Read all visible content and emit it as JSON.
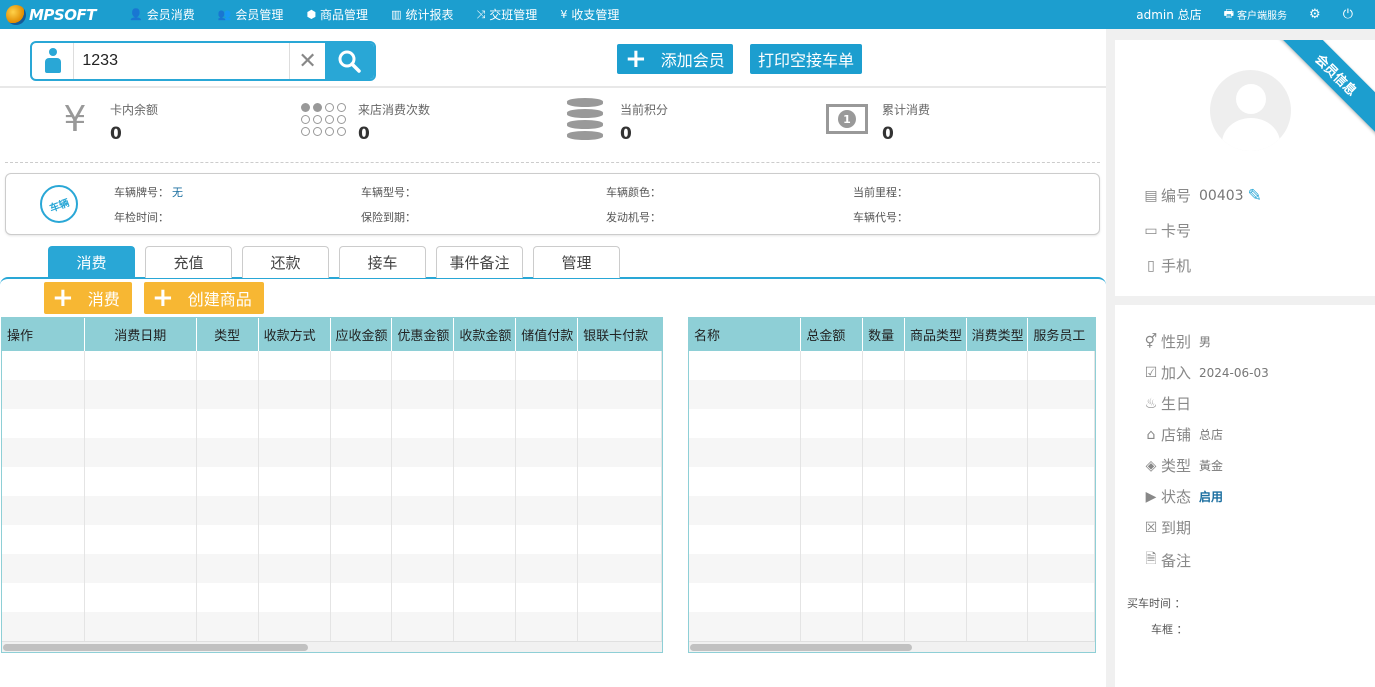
{
  "nav": {
    "logo": "MPSOFT",
    "items": [
      {
        "label": "会员消费",
        "icon": "user-circle-icon",
        "glyph": "👤"
      },
      {
        "label": "会员管理",
        "icon": "users-icon",
        "glyph": "👥"
      },
      {
        "label": "商品管理",
        "icon": "cubes-icon",
        "glyph": "⬢"
      },
      {
        "label": "统计报表",
        "icon": "bar-chart-icon",
        "glyph": "▥"
      },
      {
        "label": "交班管理",
        "icon": "shuffle-icon",
        "glyph": "⤨"
      },
      {
        "label": "收支管理",
        "icon": "yen-icon",
        "glyph": "¥"
      }
    ],
    "user": "admin 总店",
    "client_service": "客户端服务"
  },
  "search": {
    "value": "1233",
    "placeholder": ""
  },
  "buttons": {
    "add_member": "添加会员",
    "print_pickup": "打印空接车单",
    "consume": "消费",
    "create_product": "创建商品"
  },
  "stats": [
    {
      "label": "卡内余额",
      "value": "0",
      "icon": "yen-icon"
    },
    {
      "label": "来店消费次数",
      "value": "0",
      "icon": "dots-icon"
    },
    {
      "label": "当前积分",
      "value": "0",
      "icon": "coins-icon"
    },
    {
      "label": "累计消费",
      "value": "0",
      "icon": "money-icon"
    }
  ],
  "vehicle": {
    "badge": "车辆",
    "plate_label": "车辆牌号：",
    "plate_value": "无",
    "model_label": "车辆型号：",
    "color_label": "车辆颜色：",
    "mileage_label": "当前里程：",
    "inspection_label": "年检时间：",
    "insurance_label": "保险到期：",
    "engine_label": "发动机号：",
    "code_label": "车辆代号："
  },
  "tabs": [
    "消费",
    "充值",
    "还款",
    "接车",
    "事件备注",
    "管理"
  ],
  "left_table": {
    "columns": [
      "操作",
      "消费日期",
      "类型",
      "收款方式",
      "应收金额",
      "优惠金额",
      "收款金额",
      "储值付款",
      "银联卡付款"
    ]
  },
  "right_table": {
    "columns": [
      "名称",
      "总金额",
      "数量",
      "商品类型",
      "消费类型",
      "服务员工"
    ]
  },
  "member": {
    "ribbon": "会员信息",
    "number_label": "编号",
    "number_value": "00403",
    "card_label": "卡号",
    "phone_label": "手机",
    "gender_label": "性别",
    "gender_value": "男",
    "join_label": "加入",
    "join_value": "2024-06-03",
    "birthday_label": "生日",
    "store_label": "店铺",
    "store_value": "总店",
    "type_label": "类型",
    "type_value": "黃金",
    "status_label": "状态",
    "status_value": "启用",
    "expire_label": "到期",
    "note_label": "备注",
    "buy_time_label": "买车时间 ：",
    "frame_label": "车框 ："
  }
}
